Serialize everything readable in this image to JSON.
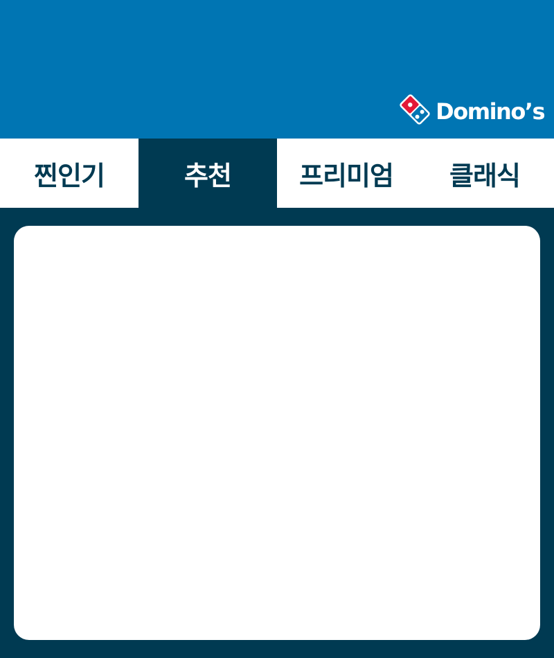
{
  "header": {
    "brand": "Domino’s",
    "colors": {
      "header_bg": "#0075b3",
      "dark": "#003a52",
      "logo_red": "#e31837",
      "white": "#ffffff"
    }
  },
  "tabs": [
    {
      "label": "찐인기",
      "active": false
    },
    {
      "label": "추천",
      "active": true
    },
    {
      "label": "프리미엄",
      "active": false
    },
    {
      "label": "클래식",
      "active": false
    }
  ]
}
